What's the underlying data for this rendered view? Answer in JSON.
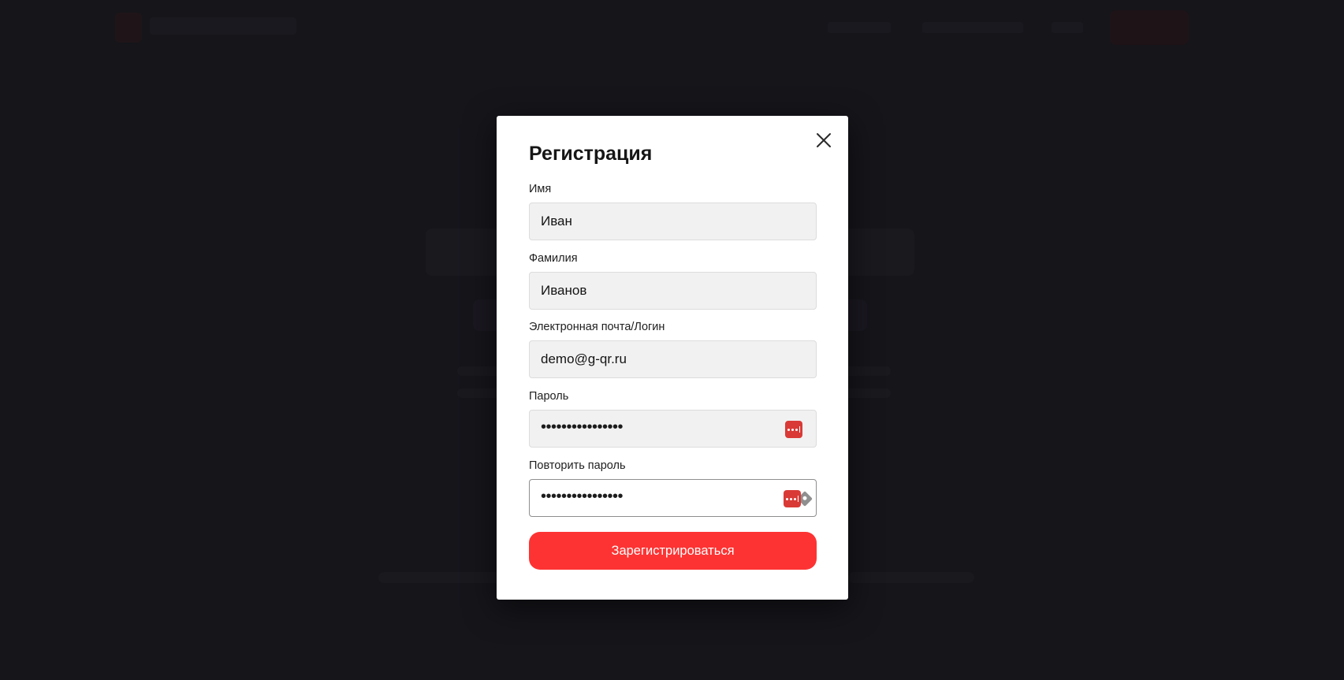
{
  "modal": {
    "title": "Регистрация",
    "close_icon": "close-icon"
  },
  "form": {
    "first_name": {
      "label": "Имя",
      "value": "Иван"
    },
    "last_name": {
      "label": "Фамилия",
      "value": "Иванов"
    },
    "email": {
      "label": "Электронная почта/Логин",
      "value": "demo@g-qr.ru"
    },
    "password": {
      "label": "Пароль",
      "value": "••••••••••••••••",
      "icon": "password-key-icon"
    },
    "confirm_password": {
      "label": "Повторить пароль",
      "value": "••••••••••••••••",
      "icon": "password-key-icon",
      "focused": true
    },
    "submit_label": "Зарегистрироваться"
  },
  "colors": {
    "accent": "#fd3333",
    "backdrop": "#1c1c21",
    "input_bg": "#f1f1f1",
    "password_key": "#d93a36"
  }
}
